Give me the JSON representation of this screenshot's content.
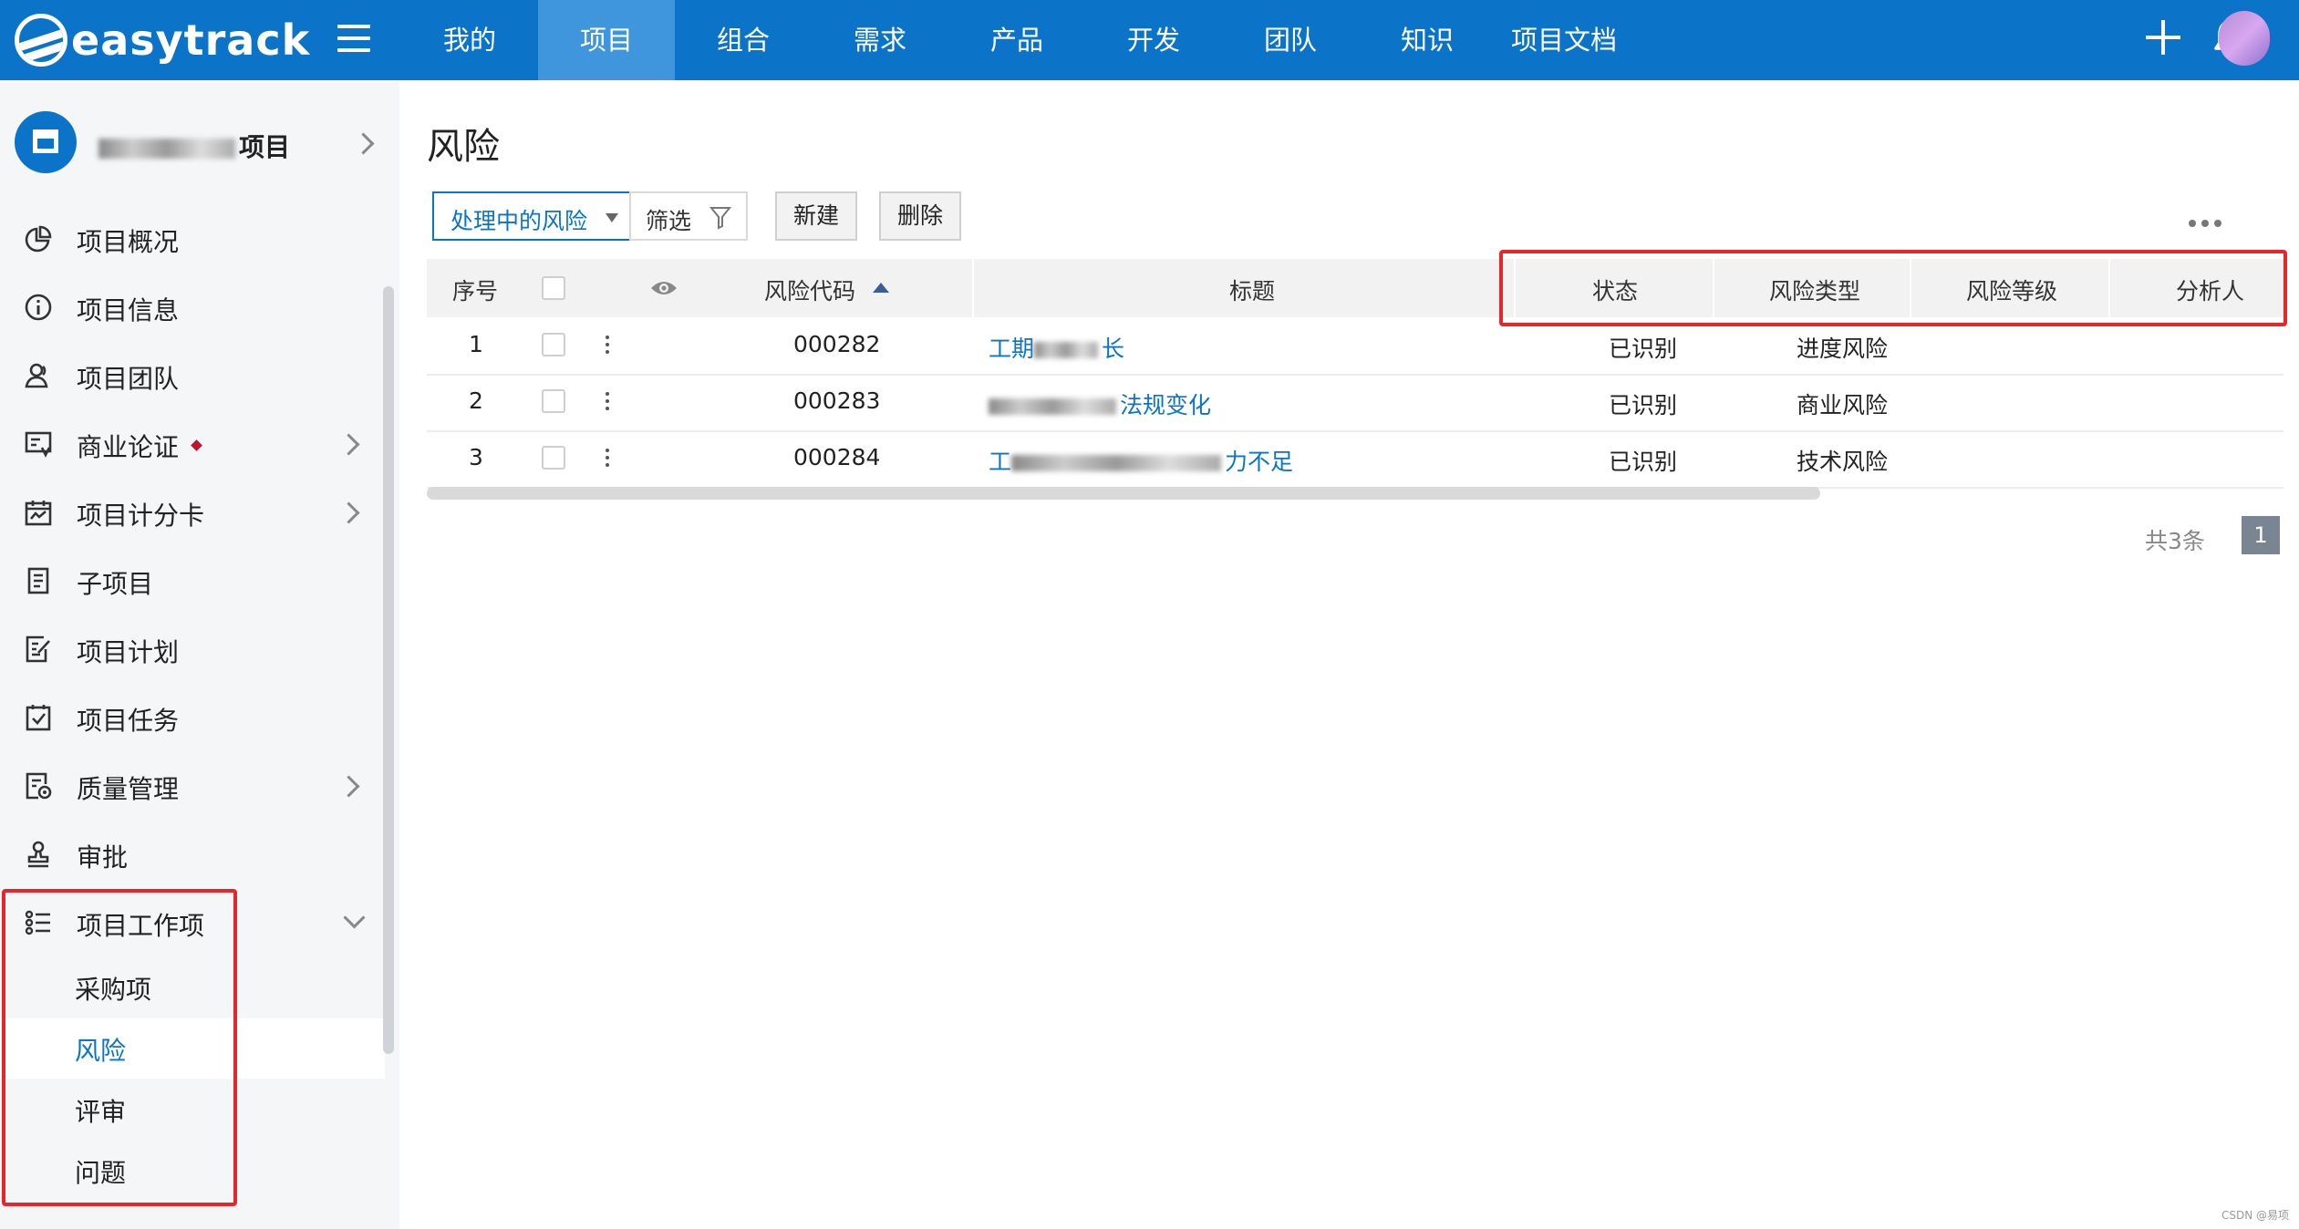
{
  "app": {
    "logo_text": "easytrack"
  },
  "nav": {
    "items": [
      {
        "label": "我的"
      },
      {
        "label": "项目"
      },
      {
        "label": "组合"
      },
      {
        "label": "需求"
      },
      {
        "label": "产品"
      },
      {
        "label": "开发"
      },
      {
        "label": "团队"
      },
      {
        "label": "知识"
      },
      {
        "label": "项目文档"
      }
    ],
    "active_index": 1
  },
  "sidebar": {
    "project_name_suffix": "项目",
    "items": [
      {
        "label": "项目概况",
        "icon": "pie-chart-icon"
      },
      {
        "label": "项目信息",
        "icon": "info-icon"
      },
      {
        "label": "项目团队",
        "icon": "team-icon"
      },
      {
        "label": "商业论证",
        "icon": "business-case-icon",
        "badge": true,
        "expandable": true
      },
      {
        "label": "项目计分卡",
        "icon": "scorecard-icon",
        "expandable": true
      },
      {
        "label": "子项目",
        "icon": "subproject-icon"
      },
      {
        "label": "项目计划",
        "icon": "plan-icon"
      },
      {
        "label": "项目任务",
        "icon": "task-icon"
      },
      {
        "label": "质量管理",
        "icon": "quality-icon",
        "expandable": true
      },
      {
        "label": "审批",
        "icon": "stamp-icon"
      },
      {
        "label": "项目工作项",
        "icon": "list-icon",
        "expanded": true
      }
    ],
    "sub_items": [
      {
        "label": "采购项"
      },
      {
        "label": "风险",
        "active": true
      },
      {
        "label": "评审"
      },
      {
        "label": "问题"
      }
    ]
  },
  "main": {
    "title": "风险",
    "toolbar": {
      "view_select": "处理中的风险",
      "filter_label": "筛选",
      "new_label": "新建",
      "delete_label": "删除"
    },
    "table": {
      "headers": {
        "index": "序号",
        "code": "风险代码",
        "title": "标题",
        "status": "状态",
        "risk_type": "风险类型",
        "risk_level": "风险等级",
        "analyst": "分析人"
      },
      "rows": [
        {
          "index": "1",
          "code": "000282",
          "title": "工期",
          "title_tail": "长",
          "status": "已识别",
          "risk_type": "进度风险",
          "risk_level": "",
          "analyst": ""
        },
        {
          "index": "2",
          "code": "000283",
          "title": "",
          "title_tail": "法规变化",
          "status": "已识别",
          "risk_type": "商业风险",
          "risk_level": "",
          "analyst": ""
        },
        {
          "index": "3",
          "code": "000284",
          "title": "工",
          "title_tail": "力不足",
          "status": "已识别",
          "risk_type": "技术风险",
          "risk_level": "",
          "analyst": ""
        }
      ]
    },
    "pagination": {
      "total_text": "共3条",
      "current_page": "1"
    }
  },
  "watermark": "CSDN @易项",
  "colors": {
    "brand": "#0b74c9",
    "nav_active": "#3f96dc",
    "highlight_box": "#e6262c",
    "badge": "#c8102e"
  }
}
